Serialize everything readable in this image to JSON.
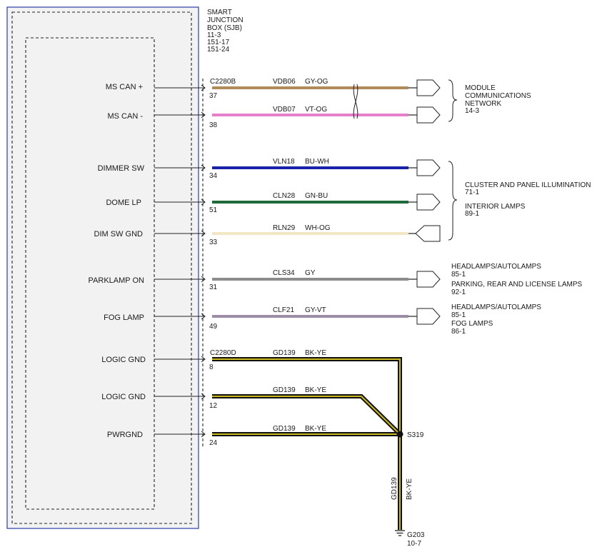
{
  "sjb": {
    "title_lines": [
      "SMART",
      "JUNCTION",
      "BOX (SJB)",
      "11-3",
      "151-17",
      "151-24"
    ],
    "connector_top": "C2280B",
    "connector_bottom": "C2280D"
  },
  "circuits": [
    {
      "label": "MS CAN +",
      "pin": "37",
      "circuit": "VDB06",
      "color_code": "GY-OG",
      "color": "#b08a58"
    },
    {
      "label": "MS CAN -",
      "pin": "38",
      "circuit": "VDB07",
      "color_code": "VT-OG",
      "color": "#e680c8"
    },
    {
      "label": "DIMMER SW",
      "pin": "34",
      "circuit": "VLN18",
      "color_code": "BU-WH",
      "color": "#1a22a8"
    },
    {
      "label": "DOME LP",
      "pin": "51",
      "circuit": "CLN28",
      "color_code": "GN-BU",
      "color": "#1f6a3a"
    },
    {
      "label": "DIM SW GND",
      "pin": "33",
      "circuit": "RLN29",
      "color_code": "WH-OG",
      "color": "#f2e6c4"
    },
    {
      "label": "PARKLAMP ON",
      "pin": "31",
      "circuit": "CLS34",
      "color_code": "GY",
      "color": "#8c8c8c"
    },
    {
      "label": "FOG LAMP",
      "pin": "49",
      "circuit": "CLF21",
      "color_code": "GY-VT",
      "color": "#9c8ca6"
    },
    {
      "label": "LOGIC GND",
      "pin": "8",
      "circuit": "GD139",
      "color_code": "BK-YE",
      "color": "#c9b820"
    },
    {
      "label": "LOGIC GND",
      "pin": "12",
      "circuit": "GD139",
      "color_code": "BK-YE",
      "color": "#c9b820"
    },
    {
      "label": "PWRGND",
      "pin": "24",
      "circuit": "GD139",
      "color_code": "BK-YE",
      "color": "#c9b820"
    }
  ],
  "destinations": {
    "module_comm": [
      "MODULE",
      "COMMUNICATIONS",
      "NETWORK",
      "14-3"
    ],
    "cluster": [
      "CLUSTER AND PANEL ILLUMINATION",
      "71-1"
    ],
    "interior": [
      "INTERIOR LAMPS",
      "89-1"
    ],
    "headlamps1": [
      "HEADLAMPS/AUTOLAMPS",
      "85-1"
    ],
    "parking": [
      "PARKING, REAR AND LICENSE LAMPS",
      "92-1"
    ],
    "headlamps2": [
      "HEADLAMPS/AUTOLAMPS",
      "85-1"
    ],
    "foglamps": [
      "FOG LAMPS",
      "86-1"
    ]
  },
  "splice": "S319",
  "ground_wire": {
    "circuit": "GD139",
    "color_code": "BK-YE"
  },
  "ground": {
    "name": "G203",
    "ref": "10-7"
  }
}
